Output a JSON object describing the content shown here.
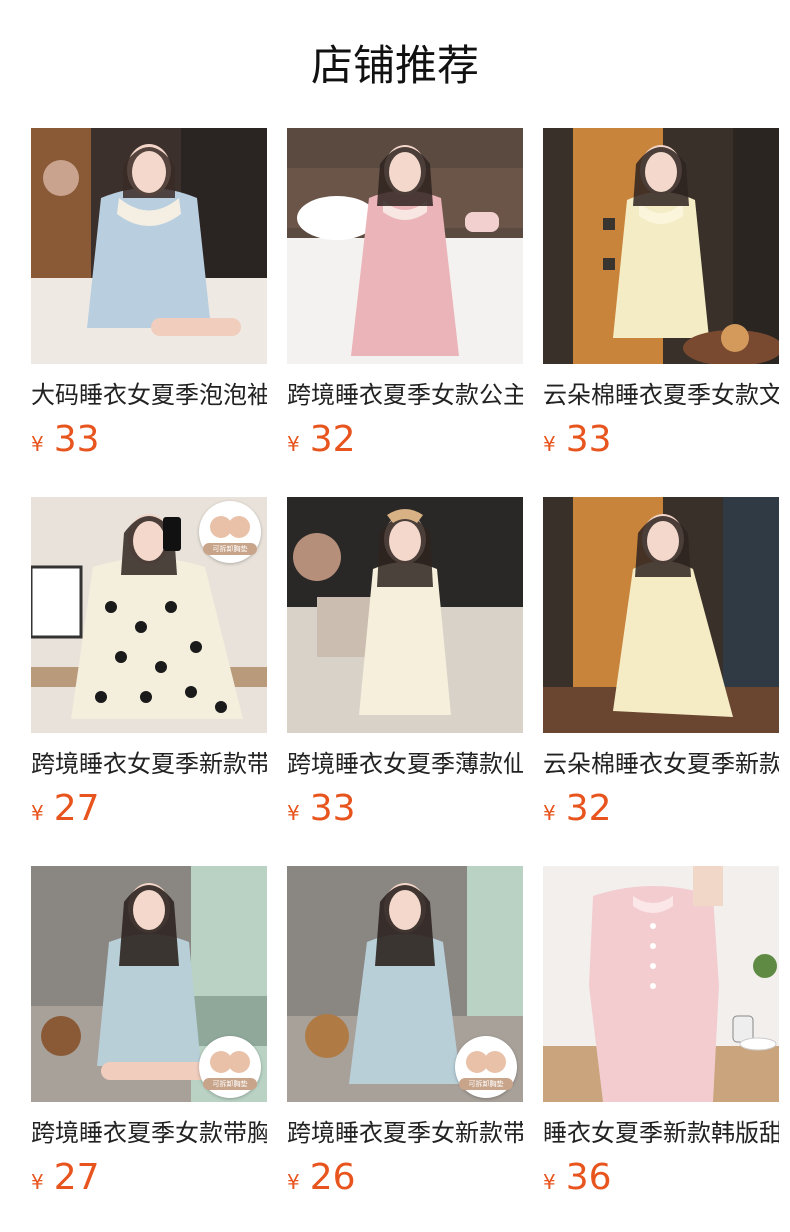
{
  "header": {
    "title": "店铺推荐"
  },
  "currency_symbol": "¥",
  "badge_text": "可拆卸胸垫",
  "products": [
    {
      "name": "大码睡衣女夏季泡泡袖",
      "price": "33"
    },
    {
      "name": "跨境睡衣夏季女款公主",
      "price": "32"
    },
    {
      "name": "云朵棉睡衣夏季女款文",
      "price": "33"
    },
    {
      "name": "跨境睡衣女夏季新款带",
      "price": "27"
    },
    {
      "name": "跨境睡衣女夏季薄款仙",
      "price": "33"
    },
    {
      "name": "云朵棉睡衣女夏季新款",
      "price": "32"
    },
    {
      "name": "跨境睡衣夏季女款带胸",
      "price": "27"
    },
    {
      "name": "跨境睡衣夏季女新款带",
      "price": "26"
    },
    {
      "name": "睡衣女夏季新款韩版甜",
      "price": "36"
    }
  ],
  "colors": {
    "price": "#e8541d",
    "title": "#111111"
  },
  "icons": [
    "product-photo",
    "chest-pad-badge-icon"
  ]
}
